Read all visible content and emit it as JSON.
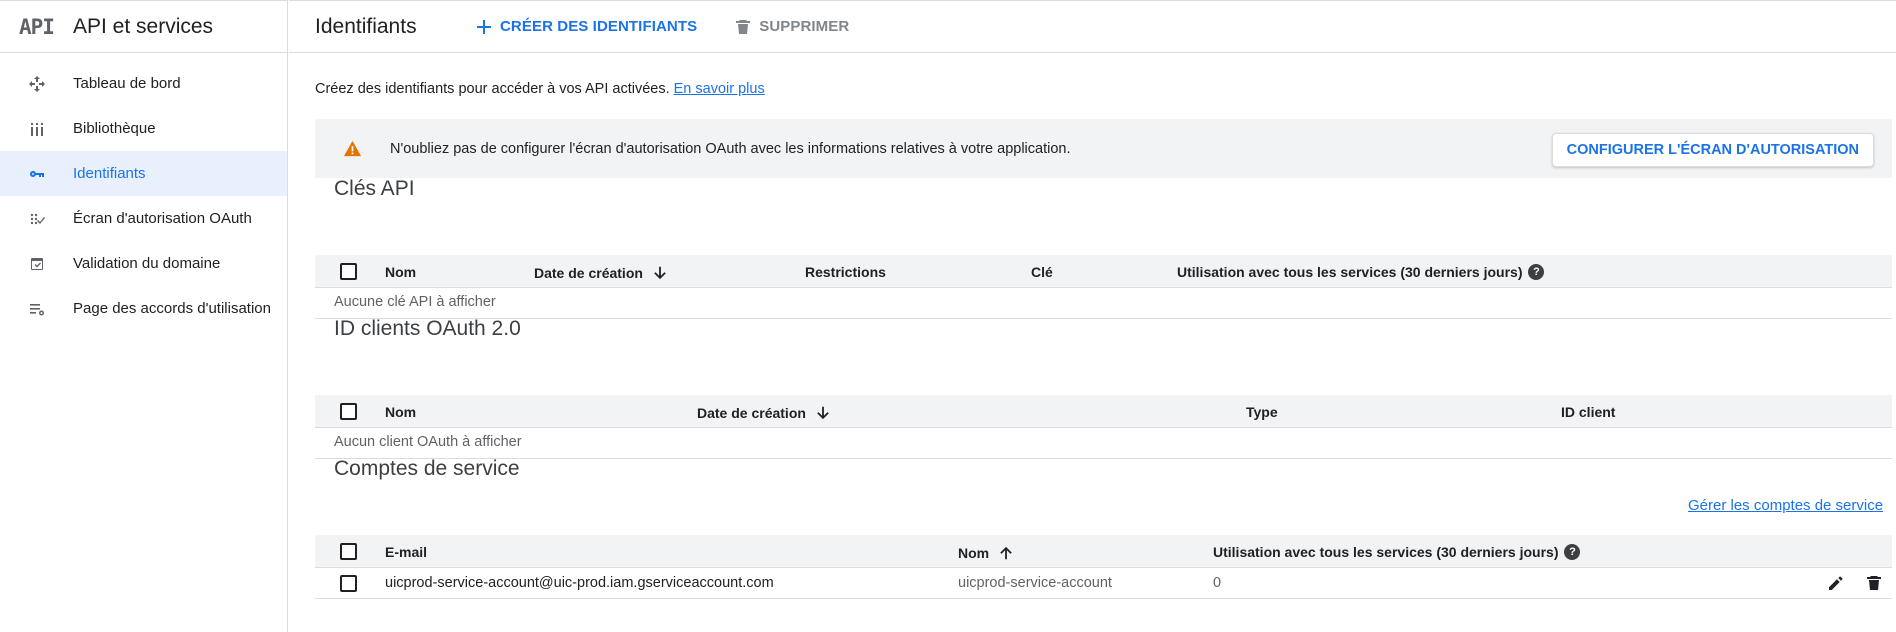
{
  "sidebar": {
    "logo": "API",
    "title": "API et services",
    "items": [
      {
        "label": "Tableau de bord",
        "icon": "dashboard-icon"
      },
      {
        "label": "Bibliothèque",
        "icon": "library-icon"
      },
      {
        "label": "Identifiants",
        "icon": "key-icon",
        "active": true
      },
      {
        "label": "Écran d'autorisation OAuth",
        "icon": "oauth-consent-icon"
      },
      {
        "label": "Validation du domaine",
        "icon": "domain-verification-icon"
      },
      {
        "label": "Page des accords d'utilisation",
        "icon": "agreements-icon"
      }
    ]
  },
  "toolbar": {
    "title": "Identifiants",
    "create_label": "CRÉER DES IDENTIFIANTS",
    "delete_label": "SUPPRIMER"
  },
  "intro": {
    "text": "Créez des identifiants pour accéder à vos API activées.",
    "link": "En savoir plus"
  },
  "banner": {
    "message": "N'oubliez pas de configurer l'écran d'autorisation OAuth avec les informations relatives à votre application.",
    "button": "CONFIGURER L'ÉCRAN D'AUTORISATION"
  },
  "api_keys": {
    "title": "Clés API",
    "columns": [
      "Nom",
      "Date de création",
      "Restrictions",
      "Clé",
      "Utilisation avec tous les services (30 derniers jours)"
    ],
    "empty": "Aucune clé API à afficher"
  },
  "oauth_clients": {
    "title": "ID clients OAuth 2.0",
    "columns": [
      "Nom",
      "Date de création",
      "Type",
      "ID client"
    ],
    "empty": "Aucun client OAuth à afficher"
  },
  "service_accounts": {
    "title": "Comptes de service",
    "manage_link": "Gérer les comptes de service",
    "columns": [
      "E-mail",
      "Nom",
      "Utilisation avec tous les services (30 derniers jours)"
    ],
    "rows": [
      {
        "email": "uicprod-service-account@uic-prod.iam.gserviceaccount.com",
        "name": "uicprod-service-account",
        "usage": "0"
      }
    ]
  },
  "colors": {
    "accent": "#1a73e8",
    "warning": "#e37400",
    "active_bg": "#e8f0fe"
  }
}
